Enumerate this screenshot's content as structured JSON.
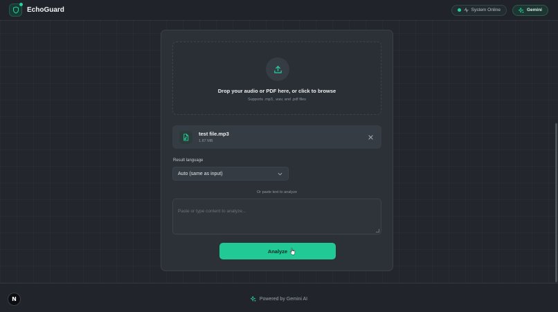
{
  "header": {
    "brand": "EchoGuard",
    "status": "System Online",
    "model": "Gemini"
  },
  "upload": {
    "title": "Drop your audio or PDF here, or click to browse",
    "subtitle": "Supports .mp3, .wav, and .pdf files"
  },
  "file": {
    "name": "test file.mp3",
    "size": "1.87 MB"
  },
  "language": {
    "label": "Result language",
    "selected": "Auto (same as input)"
  },
  "text_input": {
    "divider": "Or paste text to analyze",
    "placeholder": "Paste or type content to analyze..."
  },
  "actions": {
    "analyze": "Analyze"
  },
  "footer": {
    "text": "Powered by Gemini AI",
    "badge": "N"
  },
  "colors": {
    "accent": "#21c995",
    "background": "#23272d",
    "card": "#2c3137"
  }
}
